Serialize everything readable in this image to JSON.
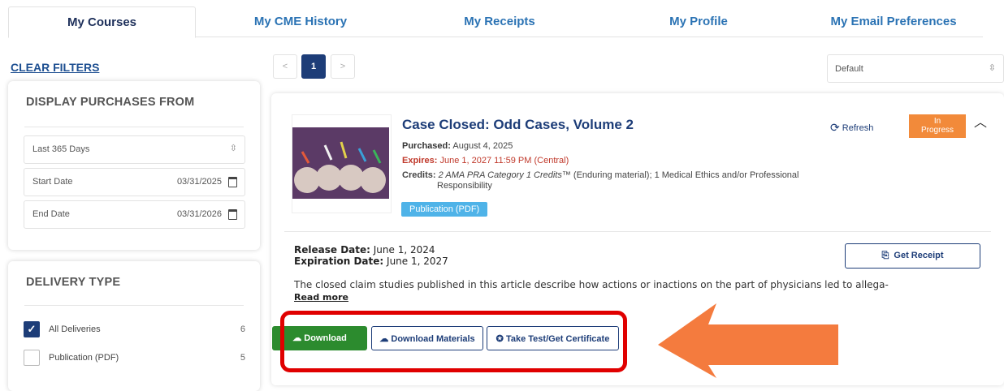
{
  "tabs": [
    {
      "label": "My Courses",
      "active": true
    },
    {
      "label": "My CME History"
    },
    {
      "label": "My Receipts"
    },
    {
      "label": "My Profile"
    },
    {
      "label": "My Email Preferences"
    }
  ],
  "sidebar": {
    "clear_filters": "CLEAR FILTERS",
    "purchases": {
      "title": "DISPLAY PURCHASES FROM",
      "range": "Last 365 Days",
      "start_label": "Start Date",
      "start_value": "03/31/2025",
      "end_label": "End Date",
      "end_value": "03/31/2026"
    },
    "delivery": {
      "title": "DELIVERY TYPE",
      "items": [
        {
          "label": "All Deliveries",
          "count": "6",
          "checked": true
        },
        {
          "label": "Publication (PDF)",
          "count": "5",
          "checked": false
        }
      ]
    }
  },
  "pagination": {
    "prev": "<",
    "current": "1",
    "next": ">"
  },
  "sort": {
    "selected": "Default"
  },
  "course": {
    "title": "Case Closed: Odd Cases, Volume 2",
    "purchased_label": "Purchased:",
    "purchased_value": "August 4, 2025",
    "expires_label": "Expires:",
    "expires_value": "June 1, 2027 11:59 PM (Central)",
    "credits_label": "Credits:",
    "credits_italic": "2 AMA PRA Category 1 Credits™",
    "credits_rest": " (Enduring material); 1 Medical Ethics and/or Professional",
    "credits_line2": "Responsibility",
    "format": "Publication (PDF)",
    "refresh": "Refresh",
    "status_line1": "In",
    "status_line2": "Progress",
    "release_label": "Release Date:",
    "release_value": "June 1, 2024",
    "expiration_label": "Expiration Date:",
    "expiration_value": "June 1, 2027",
    "description": "The closed claim studies published in this article describe how actions or inactions on the part of physicians led to allega-",
    "read_more": "Read more",
    "get_receipt": "Get Receipt",
    "buttons": {
      "download": "Download",
      "download_materials": "Download Materials",
      "take_test": "Take Test/Get Certificate"
    }
  },
  "colors": {
    "primary": "#1d3d78",
    "link": "#2b73b4",
    "green": "#2c8b2e",
    "status_orange": "#f28a3a",
    "pill_blue": "#4fb3e8",
    "highlight_red": "#e00000",
    "arrow_orange": "#f47b3e"
  }
}
